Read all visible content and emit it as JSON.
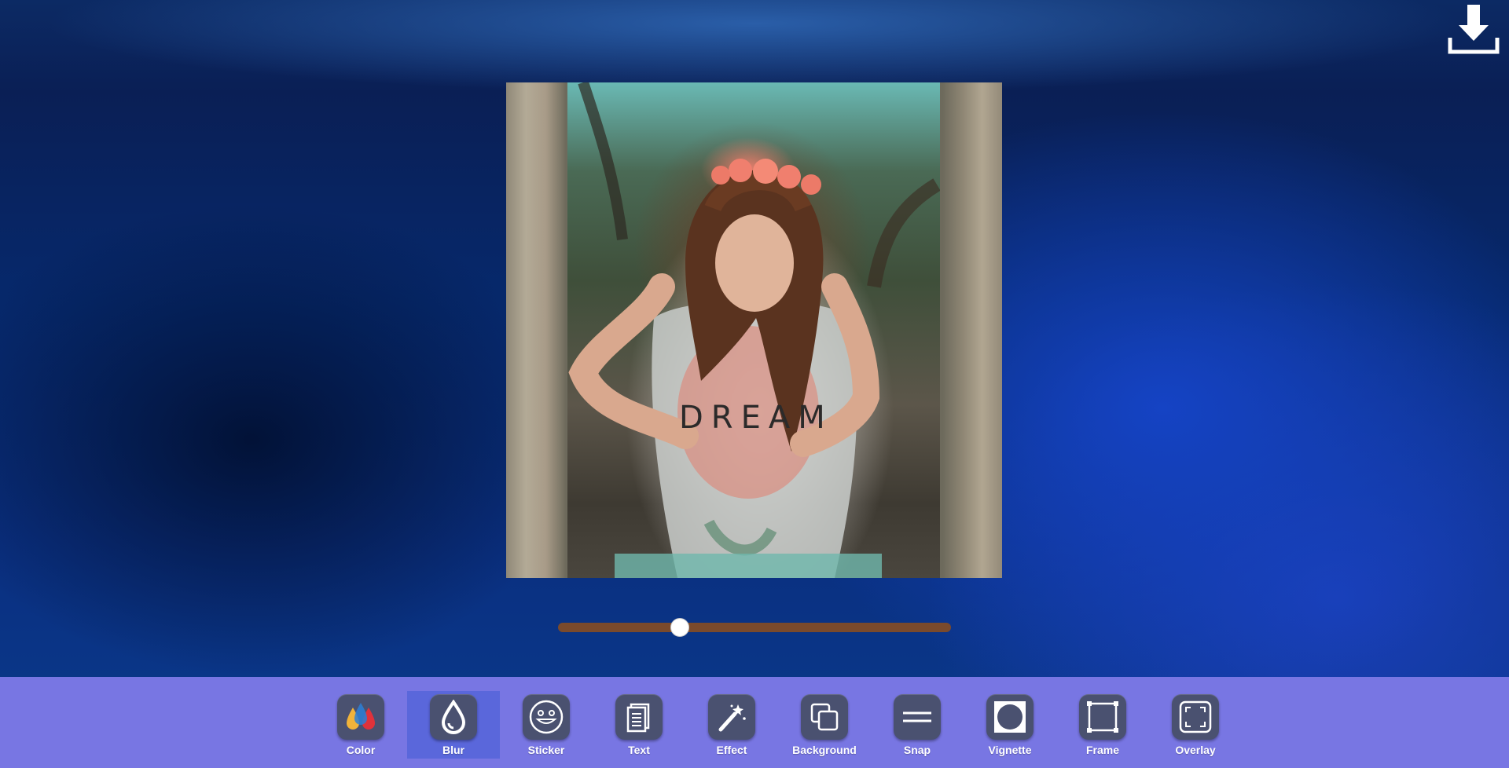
{
  "photo": {
    "shirt_text": "DREAM"
  },
  "blur_slider": {
    "value_fraction": 0.31,
    "track_color": "#7a4a2c"
  },
  "download": {
    "icon": "download-icon"
  },
  "toolbar": {
    "background_color": "#7876e3",
    "active_color": "#5a67db",
    "active_tool": "Blur",
    "tools": [
      {
        "label": "Color",
        "icon": "color-drops-icon"
      },
      {
        "label": "Blur",
        "icon": "blur-drop-icon"
      },
      {
        "label": "Sticker",
        "icon": "smiley-icon"
      },
      {
        "label": "Text",
        "icon": "text-document-icon"
      },
      {
        "label": "Effect",
        "icon": "magic-wand-icon"
      },
      {
        "label": "Background",
        "icon": "layers-icon"
      },
      {
        "label": "Snap",
        "icon": "equals-lines-icon"
      },
      {
        "label": "Vignette",
        "icon": "vignette-icon"
      },
      {
        "label": "Frame",
        "icon": "frame-icon"
      },
      {
        "label": "Overlay",
        "icon": "overlay-corners-icon"
      }
    ]
  }
}
